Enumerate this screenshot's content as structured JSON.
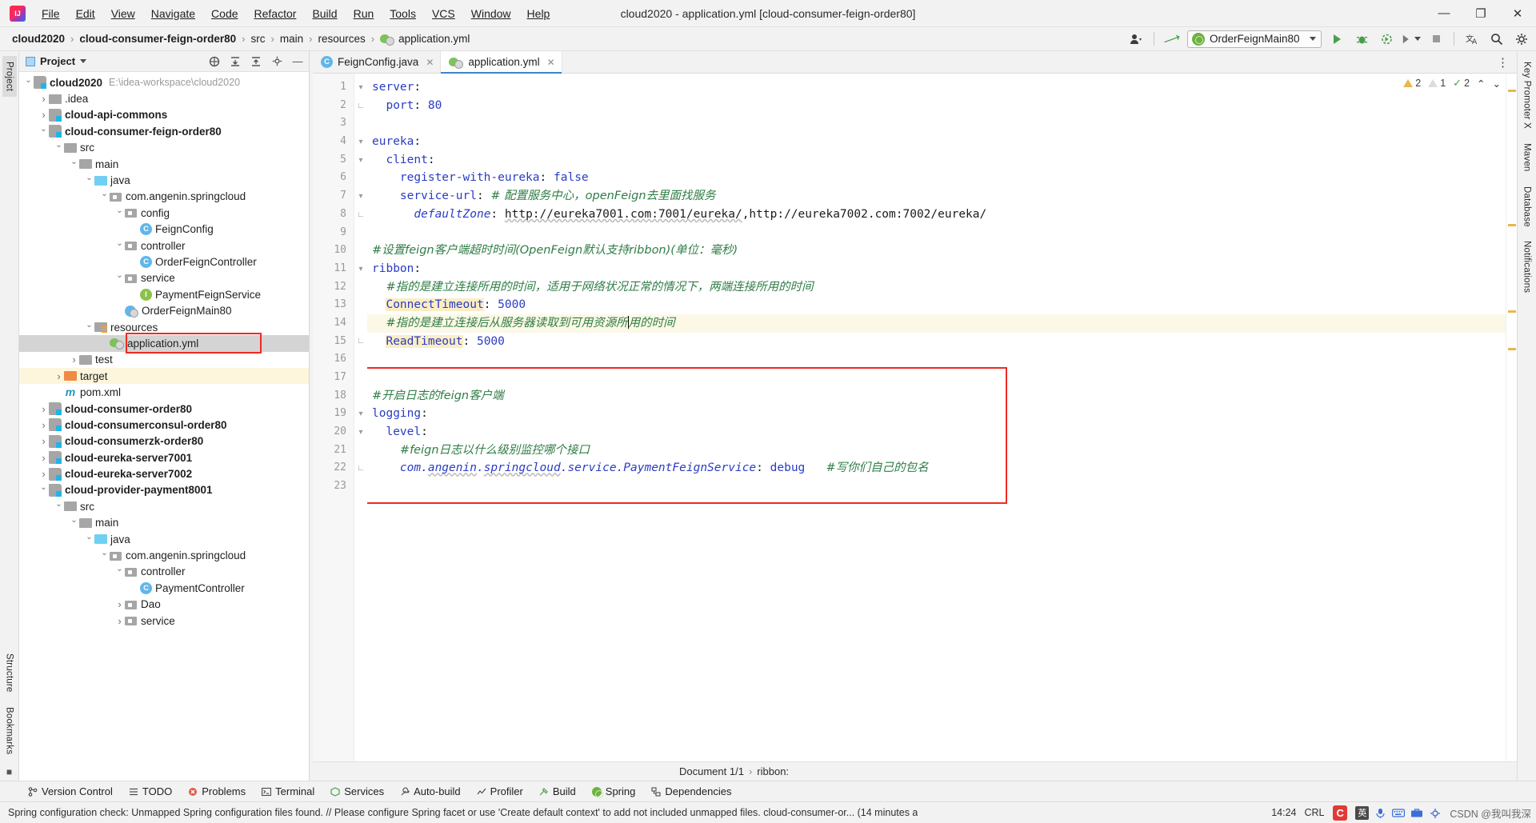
{
  "window": {
    "title": "cloud2020 - application.yml [cloud-consumer-feign-order80]",
    "minimize": "—",
    "maximize": "❐",
    "close": "✕"
  },
  "menu": [
    "File",
    "Edit",
    "View",
    "Navigate",
    "Code",
    "Refactor",
    "Build",
    "Run",
    "Tools",
    "VCS",
    "Window",
    "Help"
  ],
  "breadcrumb": {
    "items": [
      "cloud2020",
      "cloud-consumer-feign-order80",
      "src",
      "main",
      "resources",
      "application.yml"
    ],
    "separator": "›"
  },
  "toolbar": {
    "run_config": "OrderFeignMain80",
    "run_label": "Run",
    "debug_label": "Debug",
    "coverage_label": "Run with Coverage",
    "profiler_label": "Profiler",
    "stop_label": "Stop",
    "translate_label": "Translate",
    "search_label": "Search Everywhere",
    "settings_label": "Settings",
    "user_label": "Account",
    "updates_label": "Update Project"
  },
  "project_panel": {
    "title": "Project",
    "select_opened_label": "Select Opened File",
    "expand_all_label": "Expand All",
    "collapse_all_label": "Collapse All",
    "settings_label": "Options",
    "hide_label": "Hide"
  },
  "tree": [
    {
      "label": "cloud2020",
      "path": "E:\\idea-workspace\\cloud2020",
      "icon": "module",
      "indent": 0,
      "arrow": "open",
      "bold": true
    },
    {
      "label": ".idea",
      "icon": "folder",
      "indent": 1,
      "arrow": "closed",
      "bold": false
    },
    {
      "label": "cloud-api-commons",
      "icon": "module",
      "indent": 1,
      "arrow": "closed",
      "bold": true
    },
    {
      "label": "cloud-consumer-feign-order80",
      "icon": "module",
      "indent": 1,
      "arrow": "open",
      "bold": true
    },
    {
      "label": "src",
      "icon": "folder",
      "indent": 2,
      "arrow": "open",
      "bold": false
    },
    {
      "label": "main",
      "icon": "folder",
      "indent": 3,
      "arrow": "open",
      "bold": false
    },
    {
      "label": "java",
      "icon": "src",
      "indent": 4,
      "arrow": "open",
      "bold": false
    },
    {
      "label": "com.angenin.springcloud",
      "icon": "pkg",
      "indent": 5,
      "arrow": "open",
      "bold": false
    },
    {
      "label": "config",
      "icon": "pkg",
      "indent": 6,
      "arrow": "open",
      "bold": false
    },
    {
      "label": "FeignConfig",
      "icon": "class",
      "indent": 7,
      "arrow": "none",
      "bold": false
    },
    {
      "label": "controller",
      "icon": "pkg",
      "indent": 6,
      "arrow": "open",
      "bold": false
    },
    {
      "label": "OrderFeignController",
      "icon": "class",
      "indent": 7,
      "arrow": "none",
      "bold": false
    },
    {
      "label": "service",
      "icon": "pkg",
      "indent": 6,
      "arrow": "open",
      "bold": false
    },
    {
      "label": "PaymentFeignService",
      "icon": "iface",
      "indent": 7,
      "arrow": "none",
      "bold": false
    },
    {
      "label": "OrderFeignMain80",
      "icon": "run",
      "indent": 6,
      "arrow": "none",
      "bold": false
    },
    {
      "label": "resources",
      "icon": "res",
      "indent": 4,
      "arrow": "open",
      "bold": false
    },
    {
      "label": "application.yml",
      "icon": "yml",
      "indent": 5,
      "arrow": "none",
      "bold": false,
      "selected": true,
      "boxed": true
    },
    {
      "label": "test",
      "icon": "folder",
      "indent": 3,
      "arrow": "closed",
      "bold": false
    },
    {
      "label": "target",
      "icon": "target",
      "indent": 2,
      "arrow": "closed",
      "bold": false,
      "yellow": true
    },
    {
      "label": "pom.xml",
      "icon": "m",
      "indent": 2,
      "arrow": "none",
      "bold": false
    },
    {
      "label": "cloud-consumer-order80",
      "icon": "module",
      "indent": 1,
      "arrow": "closed",
      "bold": true
    },
    {
      "label": "cloud-consumerconsul-order80",
      "icon": "module",
      "indent": 1,
      "arrow": "closed",
      "bold": true
    },
    {
      "label": "cloud-consumerzk-order80",
      "icon": "module",
      "indent": 1,
      "arrow": "closed",
      "bold": true
    },
    {
      "label": "cloud-eureka-server7001",
      "icon": "module",
      "indent": 1,
      "arrow": "closed",
      "bold": true
    },
    {
      "label": "cloud-eureka-server7002",
      "icon": "module",
      "indent": 1,
      "arrow": "closed",
      "bold": true
    },
    {
      "label": "cloud-provider-payment8001",
      "icon": "module",
      "indent": 1,
      "arrow": "open",
      "bold": true
    },
    {
      "label": "src",
      "icon": "folder",
      "indent": 2,
      "arrow": "open",
      "bold": false
    },
    {
      "label": "main",
      "icon": "folder",
      "indent": 3,
      "arrow": "open",
      "bold": false
    },
    {
      "label": "java",
      "icon": "src",
      "indent": 4,
      "arrow": "open",
      "bold": false
    },
    {
      "label": "com.angenin.springcloud",
      "icon": "pkg",
      "indent": 5,
      "arrow": "open",
      "bold": false
    },
    {
      "label": "controller",
      "icon": "pkg",
      "indent": 6,
      "arrow": "open",
      "bold": false
    },
    {
      "label": "PaymentController",
      "icon": "class",
      "indent": 7,
      "arrow": "none",
      "bold": false
    },
    {
      "label": "Dao",
      "icon": "pkg",
      "indent": 6,
      "arrow": "closed",
      "bold": false
    },
    {
      "label": "service",
      "icon": "pkg",
      "indent": 6,
      "arrow": "closed",
      "bold": false
    }
  ],
  "left_strip": [
    "Project",
    "Structure",
    "Bookmarks"
  ],
  "right_strip": [
    "Key Promoter X",
    "Maven",
    "Database",
    "Notifications"
  ],
  "editor_tabs": [
    {
      "label": "FeignConfig.java",
      "icon": "class",
      "active": false
    },
    {
      "label": "application.yml",
      "icon": "yml",
      "active": true
    }
  ],
  "inspections": {
    "warnings": "2",
    "weak_warnings": "1",
    "checks": "2",
    "chevron_up": "⌃",
    "chevron_down": "⌄"
  },
  "code_lines": [
    {
      "n": 1,
      "fold": "open",
      "html": "<span class=\"k\">server</span><span class=\"str\">:</span>"
    },
    {
      "n": 2,
      "fold": "end",
      "html": "  <span class=\"k\">port</span><span class=\"str\">:</span> <span class=\"num\">80</span>"
    },
    {
      "n": 3,
      "fold": "",
      "html": ""
    },
    {
      "n": 4,
      "fold": "open",
      "html": "<span class=\"k\">eureka</span><span class=\"str\">:</span>"
    },
    {
      "n": 5,
      "fold": "open",
      "html": "  <span class=\"k\">client</span><span class=\"str\">:</span>"
    },
    {
      "n": 6,
      "fold": "",
      "html": "    <span class=\"k\">register-with-eureka</span><span class=\"str\">:</span> <span class=\"k\">false</span>"
    },
    {
      "n": 7,
      "fold": "open",
      "html": "    <span class=\"k\">service-url</span><span class=\"str\">:</span> <span class=\"cmt-cn\"># 配置服务中心，openFeign去里面找服务</span>"
    },
    {
      "n": 8,
      "fold": "end",
      "html": "      <span class=\"italicv\">defaultZone</span><span class=\"str\">:</span> <span class=\"str wavy\">http://eureka7001.com:7001/eureka/</span><span class=\"str\">,http://eureka7002.com:7002/eureka/</span>"
    },
    {
      "n": 9,
      "fold": "",
      "html": ""
    },
    {
      "n": 10,
      "fold": "",
      "html": "<span class=\"cmt-cn\">#设置feign客户端超时时间(OpenFeign默认支持ribbon)(单位：毫秒)</span>"
    },
    {
      "n": 11,
      "fold": "open",
      "html": "<span class=\"k\">ribbon</span><span class=\"str\">:</span>"
    },
    {
      "n": 12,
      "fold": "",
      "html": "  <span class=\"cmt-cn\">#指的是建立连接所用的时间，适用于网络状况正常的情况下，两端连接所用的时间</span>"
    },
    {
      "n": 13,
      "fold": "",
      "html": "  <span class=\"k mark\">ConnectTimeout</span><span class=\"str\">:</span> <span class=\"num\">5000</span>"
    },
    {
      "n": 14,
      "fold": "",
      "hl": true,
      "html": "  <span class=\"cmt-cn\">#指的是建立连接后从服务器读取到可用资源所</span><span class=\"caret\"></span><span class=\"cmt-cn\">用的时间</span>"
    },
    {
      "n": 15,
      "fold": "end",
      "html": "  <span class=\"k mark\">ReadTimeout</span><span class=\"str\">:</span> <span class=\"num\">5000</span>"
    },
    {
      "n": 16,
      "fold": "",
      "html": ""
    },
    {
      "n": 17,
      "fold": "",
      "html": ""
    },
    {
      "n": 18,
      "fold": "",
      "html": "<span class=\"cmt-cn\">#开启日志的feign客户端</span>"
    },
    {
      "n": 19,
      "fold": "open",
      "html": "<span class=\"k\">logging</span><span class=\"str\">:</span>"
    },
    {
      "n": 20,
      "fold": "open",
      "html": "  <span class=\"k\">level</span><span class=\"str\">:</span>"
    },
    {
      "n": 21,
      "fold": "",
      "html": "    <span class=\"cmt-cn\">#feign日志以什么级别监控哪个接口</span>"
    },
    {
      "n": 22,
      "fold": "end",
      "html": "    <span class=\"italicv\">com.<span class=\"wavy\">angenin</span>.<span class=\"wavy\">springcloud</span>.service.PaymentFeignService</span><span class=\"str\">:</span> <span class=\"k\">debug</span>   <span class=\"cmt-cn\">#写你们自己的包名</span>"
    },
    {
      "n": 23,
      "fold": "",
      "html": ""
    }
  ],
  "editor_breadcrumb": {
    "document": "Document 1/1",
    "node": "ribbon:",
    "separator": "›"
  },
  "bottom_tools": [
    {
      "label": "Version Control",
      "icon": "branch-icon"
    },
    {
      "label": "TODO",
      "icon": "list-icon"
    },
    {
      "label": "Problems",
      "icon": "error-icon"
    },
    {
      "label": "Terminal",
      "icon": "terminal-icon"
    },
    {
      "label": "Services",
      "icon": "services-icon"
    },
    {
      "label": "Auto-build",
      "icon": "wrench-icon"
    },
    {
      "label": "Profiler",
      "icon": "profiler-icon"
    },
    {
      "label": "Build",
      "icon": "hammer-icon"
    },
    {
      "label": "Spring",
      "icon": "spring-icon"
    },
    {
      "label": "Dependencies",
      "icon": "dependencies-icon"
    }
  ],
  "statusbar": {
    "message": "Spring configuration check: Unmapped Spring configuration files found. // Please configure Spring facet or use 'Create default context' to add not included unmapped files. cloud-consumer-or... (14 minutes a",
    "time": "14:24",
    "encoding": "CRL",
    "ime_lang": "英",
    "watermark": "CSDN @我叫我深",
    "csdn": "C"
  },
  "colors": {
    "accent": "#3c86c9",
    "annotation_red": "#ef2a24",
    "selection_gray": "#d4d4d4",
    "highlight_yellow": "#fcf8e6",
    "mark_yellow": "#fbedc4",
    "comment_green": "#2e7d45",
    "keyword_blue": "#2a3cc4",
    "spring_green": "#6db33f"
  }
}
